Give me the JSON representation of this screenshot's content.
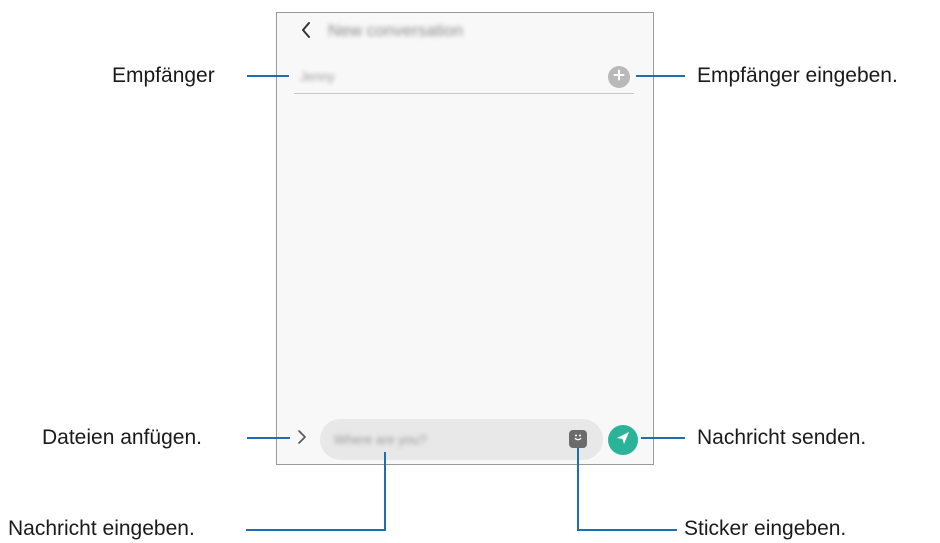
{
  "screen": {
    "header_title": "New conversation",
    "recipient_value": "Jenny",
    "message_placeholder": "Where are you?"
  },
  "callouts": {
    "recipient": "Empfänger",
    "enter_recipient": "Empfänger eingeben.",
    "attach_files": "Dateien anfügen.",
    "send_message": "Nachricht senden.",
    "enter_message": "Nachricht eingeben.",
    "enter_sticker": "Sticker eingeben."
  },
  "colors": {
    "send_button": "#2bb39a",
    "callout_line": "#1f6db3",
    "frame_border": "#9a9a9a"
  },
  "icons": {
    "back": "chevron-left-icon",
    "add_recipient": "plus-circle-icon",
    "attach": "chevron-right-icon",
    "sticker": "sticker-icon",
    "send": "paper-plane-icon"
  }
}
